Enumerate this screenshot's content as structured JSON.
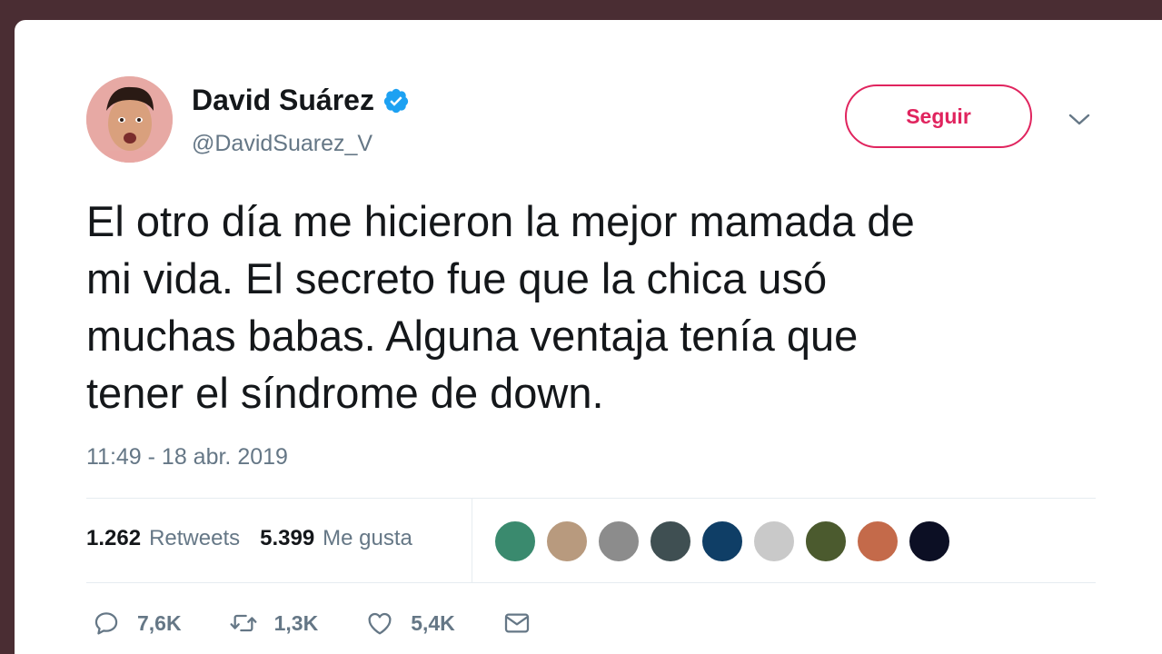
{
  "colors": {
    "background": "#4a2d33",
    "follow_accent": "#e0245e",
    "verified_blue": "#1da1f2",
    "text": "#14171a",
    "secondary_text": "#657786"
  },
  "user": {
    "display_name": "David Suárez",
    "handle": "@DavidSuarez_V",
    "verified_icon": "verified-badge-icon"
  },
  "follow_button": {
    "label": "Seguir"
  },
  "tweet": {
    "lines": [
      "El otro día me hicieron la mejor mamada de",
      "mi vida. El secreto fue que la chica usó",
      "muchas babas. Alguna ventaja tenía que",
      "tener el síndrome de down."
    ],
    "timestamp": "11:49 - 18 abr. 2019"
  },
  "stats": {
    "retweets_count": "1.262",
    "retweets_label": "Retweets",
    "likes_count": "5.399",
    "likes_label": "Me gusta"
  },
  "likers": [
    {
      "name": "liker-avatar-1",
      "color": "#3a8a6e"
    },
    {
      "name": "liker-avatar-2",
      "color": "#b89a7e"
    },
    {
      "name": "liker-avatar-3",
      "color": "#8c8c8c"
    },
    {
      "name": "liker-avatar-4",
      "color": "#3f4f52"
    },
    {
      "name": "liker-avatar-5",
      "color": "#0f3e66"
    },
    {
      "name": "liker-avatar-6",
      "color": "#c9c9c9"
    },
    {
      "name": "liker-avatar-7",
      "color": "#4b5a2e"
    },
    {
      "name": "liker-avatar-8",
      "color": "#c46a4a"
    },
    {
      "name": "liker-avatar-9",
      "color": "#0c0f24"
    }
  ],
  "actions": {
    "replies": "7,6K",
    "retweets": "1,3K",
    "likes": "5,4K"
  }
}
